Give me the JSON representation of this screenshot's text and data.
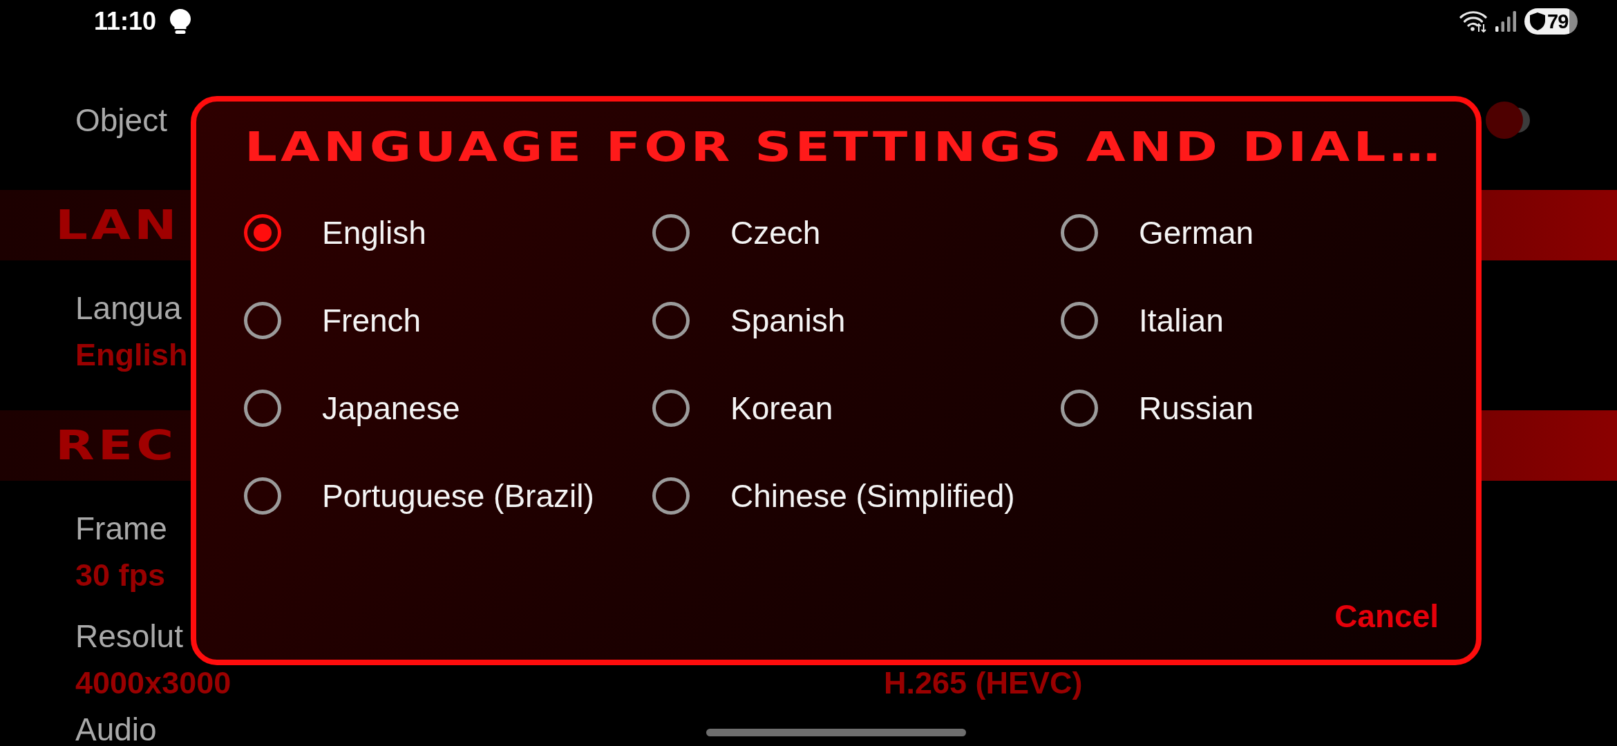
{
  "status_bar": {
    "time": "11:10",
    "battery": "79"
  },
  "settings": [
    {
      "kind": "switch",
      "label": "Object",
      "on": false
    },
    {
      "kind": "section",
      "title": "LAN"
    },
    {
      "kind": "setting",
      "cells": [
        {
          "label": "Langua",
          "value": "English"
        }
      ]
    },
    {
      "kind": "section",
      "title": "REC"
    },
    {
      "kind": "setting",
      "cells": [
        {
          "label": "Frame",
          "value": "30 fps"
        }
      ]
    },
    {
      "kind": "setting",
      "cells": [
        {
          "label": "Resolut",
          "value": "4000x3000"
        },
        {
          "value": "H.265 (HEVC)"
        }
      ]
    },
    {
      "kind": "setting",
      "cells": [
        {
          "label": "Audio"
        }
      ]
    }
  ],
  "dialog": {
    "title": "LANGUAGE FOR SETTINGS AND DIAL…",
    "options": [
      {
        "label": "English",
        "selected": true
      },
      {
        "label": "Czech",
        "selected": false
      },
      {
        "label": "German",
        "selected": false
      },
      {
        "label": "French",
        "selected": false
      },
      {
        "label": "Spanish",
        "selected": false
      },
      {
        "label": "Italian",
        "selected": false
      },
      {
        "label": "Japanese",
        "selected": false
      },
      {
        "label": "Korean",
        "selected": false
      },
      {
        "label": "Russian",
        "selected": false
      },
      {
        "label": "Portuguese (Brazil)",
        "selected": false
      },
      {
        "label": "Chinese (Simplified)",
        "selected": false
      }
    ],
    "cancel": "Cancel"
  }
}
